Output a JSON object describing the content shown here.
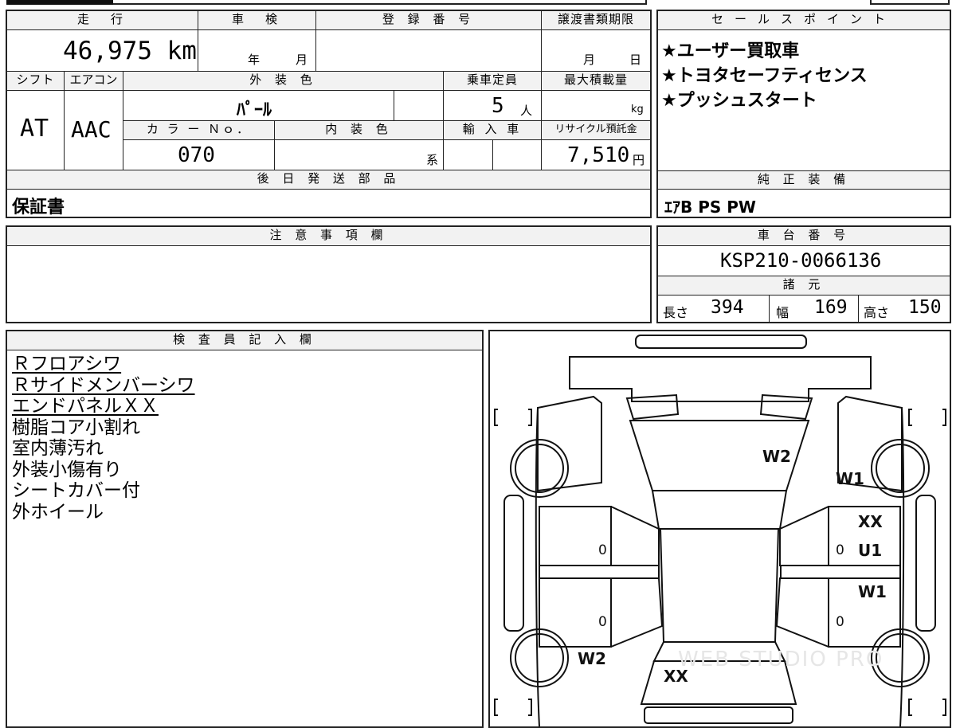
{
  "header": {
    "mileage_label": "走　行",
    "mileage_value": "46,975 km",
    "inspection_label": "車　検",
    "inspection_year": "年",
    "inspection_month": "月",
    "registration_label": "登 録 番 号",
    "transfer_label": "譲渡書類期限",
    "transfer_month": "月",
    "transfer_day": "日"
  },
  "specs": {
    "shift_label": "シフト",
    "shift_value": "AT",
    "aircon_label": "エアコン",
    "aircon_value": "AAC",
    "exterior_color_label": "外 装 色",
    "exterior_color_value": "ﾊﾟｰﾙ",
    "capacity_label": "乗車定員",
    "capacity_value": "5",
    "capacity_unit": "人",
    "max_load_label": "最大積載量",
    "max_load_unit": "kg",
    "color_no_label": "カ ラ ー Ｎｏ．",
    "color_no_value": "070",
    "interior_color_label": "内 装 色",
    "interior_suffix": "系",
    "import_label": "輸 入 車",
    "recycle_label": "リサイクル預託金",
    "recycle_value": "7,510",
    "recycle_unit": "円"
  },
  "sales_points": {
    "label": "セールスポイント",
    "items": [
      "★ユーザー買取車",
      "★トヨタセーフティセンス",
      "★プッシュスタート"
    ]
  },
  "later_parts": {
    "label": "後 日 発 送 部 品",
    "value": "保証書"
  },
  "genuine_equipment": {
    "label": "純 正 装 備",
    "value": "ｴｱB PS PW"
  },
  "notes": {
    "label": "注 意 事 項 欄"
  },
  "chassis": {
    "label": "車 台 番 号",
    "value": "KSP210-0066136"
  },
  "dimensions": {
    "label": "諸 元",
    "length_label": "長さ",
    "length_value": "394",
    "width_label": "幅",
    "width_value": "169",
    "height_label": "高さ",
    "height_value": "150"
  },
  "inspector": {
    "label": "検 査 員 記 入 欄",
    "lines": [
      {
        "text": "Ｒフロアシワ",
        "underline": true
      },
      {
        "text": "Ｒサイドメンバーシワ",
        "underline": true
      },
      {
        "text": "エンドパネルＸＸ",
        "underline": true
      },
      {
        "text": "樹脂コア小割れ",
        "underline": false
      },
      {
        "text": "室内薄汚れ",
        "underline": false
      },
      {
        "text": "外装小傷有り",
        "underline": false
      },
      {
        "text": "シートカバー付",
        "underline": false
      },
      {
        "text": "外ホイール",
        "underline": false
      }
    ]
  },
  "diagram": {
    "marks": {
      "bonnet": "W2",
      "right_front_fender": "W1",
      "right_front_door_top": "XX",
      "right_front_door": "U1",
      "right_rear_door": "W1",
      "left_rear_fender": "W2",
      "rear": "XX",
      "left_front_door_zero": "0",
      "left_rear_door_zero": "0",
      "right_front_door_zero": "0",
      "right_rear_door_zero": "0"
    },
    "watermark": "WEB STUDIO PRO"
  }
}
